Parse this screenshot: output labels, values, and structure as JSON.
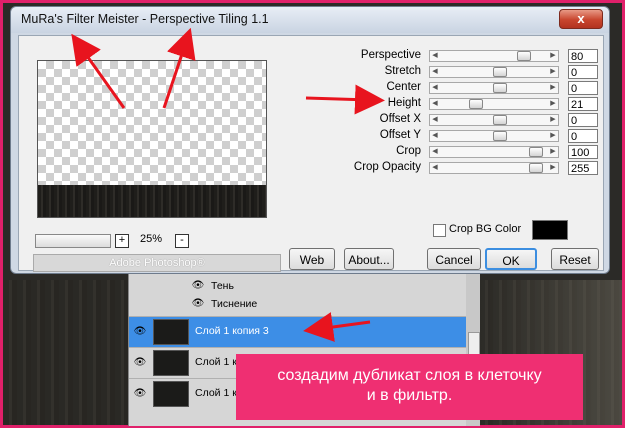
{
  "window": {
    "title": "MuRa's Filter Meister - Perspective Tiling 1.1",
    "close_label": "x"
  },
  "preview": {
    "zoom_minus": "-",
    "zoom_plus": "+",
    "zoom_level": "25%",
    "status": "Adobe Photoshop®"
  },
  "params": [
    {
      "label": "Perspective",
      "value": "80",
      "level": 0.8
    },
    {
      "label": "Stretch",
      "value": "0",
      "level": 0.55
    },
    {
      "label": "Center",
      "value": "0",
      "level": 0.55
    },
    {
      "label": "Height",
      "value": "21",
      "level": 0.3
    },
    {
      "label": "Offset X",
      "value": "0",
      "level": 0.55
    },
    {
      "label": "Offset Y",
      "value": "0",
      "level": 0.55
    },
    {
      "label": "Crop",
      "value": "100",
      "level": 0.93
    },
    {
      "label": "Crop Opacity",
      "value": "255",
      "level": 0.93
    }
  ],
  "crop_bg": {
    "label": "Crop BG Color",
    "color": "#000000"
  },
  "buttons": {
    "web": "Web",
    "about": "About...",
    "cancel": "Cancel",
    "ok": "OK",
    "reset": "Reset"
  },
  "layers": {
    "effects": [
      "Тень",
      "Тиснение"
    ],
    "rows": [
      {
        "name": "Слой 1 копия 3",
        "selected": true
      },
      {
        "name": "Слой 1 к",
        "selected": false
      },
      {
        "name": "Слой 1 к",
        "selected": false
      }
    ]
  },
  "caption": {
    "line1": "создадим дубликат слоя в клеточку",
    "line2": "и в фильтр."
  },
  "colors": {
    "frame": "#e0206a",
    "caption_bg": "#ef2f72",
    "selected_layer": "#3d8ee6",
    "arrow": "#e8141e"
  }
}
